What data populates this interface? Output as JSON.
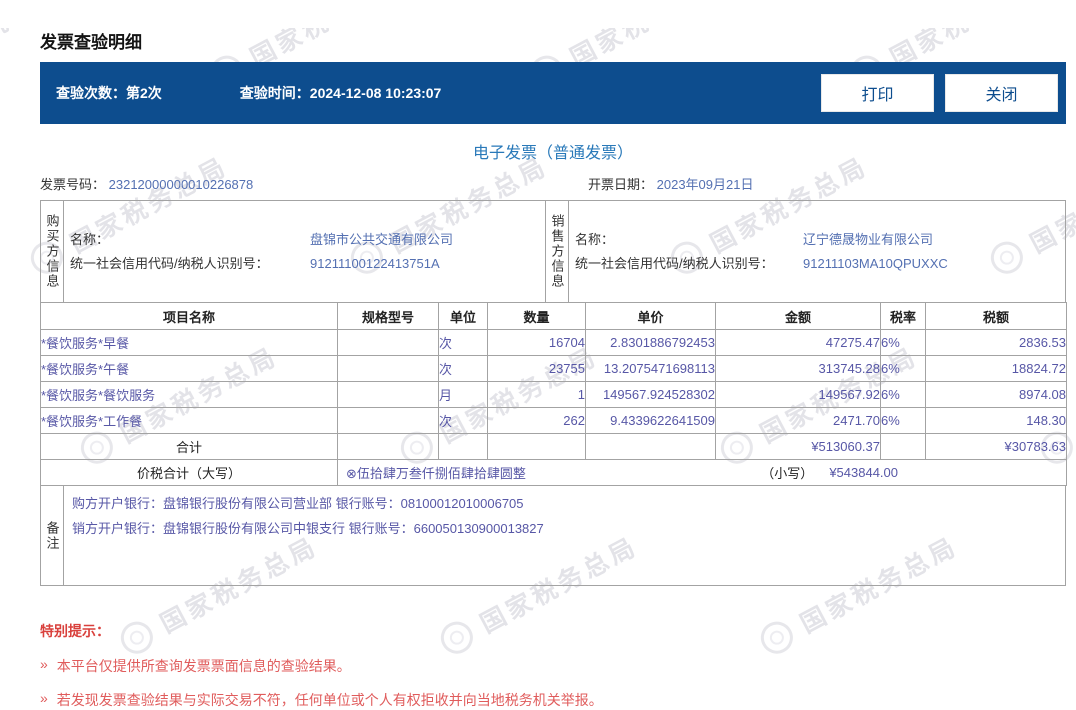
{
  "header": {
    "title": "发票查验明细"
  },
  "bar": {
    "count_label": "查验次数：",
    "count_value": "第2次",
    "time_label": "查验时间：",
    "time_value": "2024-12-08 10:23:07",
    "print_label": "打印",
    "close_label": "关闭"
  },
  "invoice": {
    "type_title": "电子发票（普通发票）",
    "number_label": "发票号码：",
    "number": "23212000000010226878",
    "date_label": "开票日期：",
    "date": "2023年09月21日"
  },
  "buyer": {
    "side_label": "购买方信息",
    "name_label": "名称：",
    "name": "盘锦市公共交通有限公司",
    "taxid_label": "统一社会信用代码/纳税人识别号：",
    "taxid": "91211100122413751A"
  },
  "seller": {
    "side_label": "销售方信息",
    "name_label": "名称：",
    "name": "辽宁德晟物业有限公司",
    "taxid_label": "统一社会信用代码/纳税人识别号：",
    "taxid": "91211103MA10QPUXXC"
  },
  "items": {
    "headers": [
      "项目名称",
      "规格型号",
      "单位",
      "数量",
      "单价",
      "金额",
      "税率",
      "税额"
    ],
    "rows": [
      {
        "name": "*餐饮服务*早餐",
        "spec": "",
        "unit": "次",
        "qty": "16704",
        "price": "2.8301886792453",
        "amount": "47275.47",
        "tax_rate": "6%",
        "tax": "2836.53"
      },
      {
        "name": "*餐饮服务*午餐",
        "spec": "",
        "unit": "次",
        "qty": "23755",
        "price": "13.2075471698113",
        "amount": "313745.28",
        "tax_rate": "6%",
        "tax": "18824.72"
      },
      {
        "name": "*餐饮服务*餐饮服务",
        "spec": "",
        "unit": "月",
        "qty": "1",
        "price": "149567.924528302",
        "amount": "149567.92",
        "tax_rate": "6%",
        "tax": "8974.08"
      },
      {
        "name": "*餐饮服务*工作餐",
        "spec": "",
        "unit": "次",
        "qty": "262",
        "price": "9.4339622641509",
        "amount": "2471.70",
        "tax_rate": "6%",
        "tax": "148.30"
      }
    ],
    "total_label": "合计",
    "total_amount": "¥513060.37",
    "total_tax": "¥30783.63"
  },
  "summary": {
    "label": "价税合计（大写）",
    "amount_words": "⊗伍拾肆万叁仟捌佰肆拾肆圆整",
    "small_label": "（小写）",
    "amount_figures": "¥543844.00"
  },
  "remarks": {
    "side_label": "备注",
    "line1": "购方开户银行：盘锦银行股份有限公司营业部 银行账号：08100012010006705",
    "line2": "销方开户银行：盘锦银行股份有限公司中银支行 银行账号：660050130900013827"
  },
  "footer": {
    "title": "特别提示：",
    "bullet": "»",
    "note1": "本平台仅提供所查询发票票面信息的查验结果。",
    "note2": "若发现发票查验结果与实际交易不符，任何单位或个人有权拒收并向当地税务机关举报。"
  },
  "watermark": {
    "text": "国家税务总局"
  },
  "colors": {
    "bar_blue": "#0d4d8e",
    "title_blue": "#2979b9",
    "value_indigo": "#5757a6",
    "value_blue": "#5470b2",
    "tip_red": "#e05c5c",
    "border_gray": "#a3a3a3",
    "watermark_gray": "#e3e3e8"
  }
}
